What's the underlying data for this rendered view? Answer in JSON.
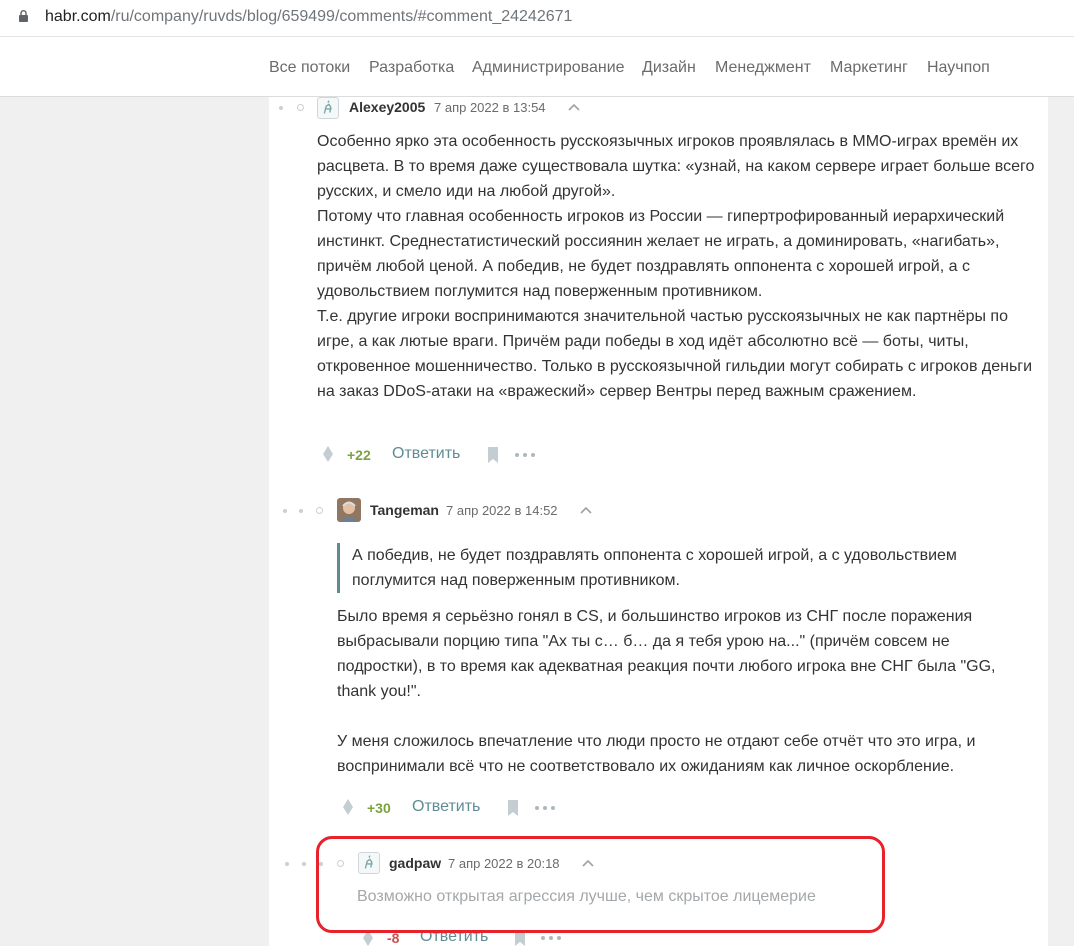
{
  "browser": {
    "url_domain": "habr.com",
    "url_path": "/ru/company/ruvds/blog/659499/comments/#comment_24242671"
  },
  "nav": {
    "items": [
      "Все потоки",
      "Разработка",
      "Администрирование",
      "Дизайн",
      "Менеджмент",
      "Маркетинг",
      "Научпоп"
    ]
  },
  "comments": [
    {
      "username": "Alexey2005",
      "date": "7 апр 2022 в 13:54",
      "paragraphs": [
        "Особенно ярко эта особенность русскоязычных игроков проявлялась в MMO-играх времён их расцвета. В то время даже существовала шутка: «узнай, на каком сервере играет больше всего русских, и смело иди на любой другой».",
        "Потому что главная особенность игроков из России — гипертрофированный иерархический инстинкт. Среднестатистический россиянин желает не играть, а доминировать, «нагибать», причём любой ценой. А победив, не будет поздравлять оппонента с хорошей игрой, а с удовольствием поглумится над поверженным противником.",
        "Т.е. другие игроки воспринимаются значительной частью русскоязычных не как партнёры по игре, а как лютые враги. Причём ради победы в ход идёт абсолютно всё — боты, читы, откровенное мошенничество. Только в русскоязычной гильдии могут собирать с игроков деньги на заказ DDoS-атаки на «вражеский» сервер Вентры перед важным сражением."
      ],
      "score": "+22",
      "reply_label": "Ответить"
    },
    {
      "username": "Tangeman",
      "date": "7 апр 2022 в 14:52",
      "quote": "А победив, не будет поздравлять оппонента с хорошей игрой, а с удовольствием поглумится над поверженным противником.",
      "paragraphs": [
        "Было время я серьёзно гонял в CS, и большинство игроков из СНГ после поражения выбрасывали порцию типа \"Ах ты с… б… да я тебя урою на...\" (причём совсем не подростки), в то время как адекватная реакция почти любого игрока вне СНГ была \"GG, thank you!\".",
        "У меня сложилось впечатление что люди просто не отдают себе отчёт что это игра, и воспринимали всё что не соответствовало их ожиданиям как личное оскорбление."
      ],
      "score": "+30",
      "reply_label": "Ответить"
    },
    {
      "username": "gadpaw",
      "date": "7 апр 2022 в 20:18",
      "text": "Возможно открытая агрессия лучше, чем скрытое лицемерие",
      "score": "-8",
      "reply_label": "Ответить"
    }
  ],
  "colors": {
    "accent": "#5e8c94",
    "positive": "#7aa33f",
    "negative": "#d04e4e",
    "highlight": "#e8222b"
  }
}
